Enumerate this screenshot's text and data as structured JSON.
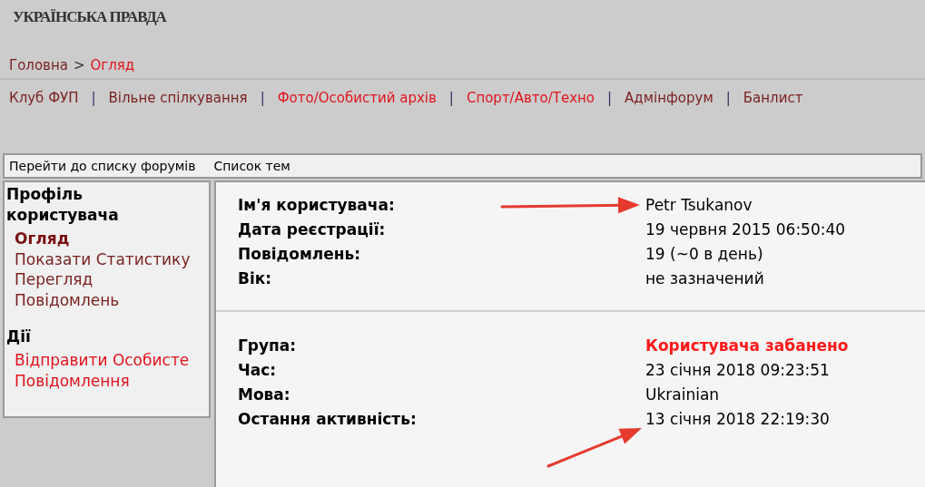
{
  "logo": "УКРАЇНСЬКА ПРАВДА",
  "breadcrumb": {
    "separator": ">",
    "items": [
      {
        "label": "Головна",
        "color": "#7a1f1f"
      },
      {
        "label": "Огляд",
        "color": "#e0141e"
      }
    ]
  },
  "forums": {
    "separator": "|",
    "items": [
      {
        "label": "Клуб ФУП",
        "color": "#7a1f1f"
      },
      {
        "label": "Вільне спілкування",
        "color": "#7a1f1f"
      },
      {
        "label": "Фото/Особистий архів",
        "color": "#e0141e"
      },
      {
        "label": "Спорт/Авто/Техно",
        "color": "#e0141e"
      },
      {
        "label": "Адмінфорум",
        "color": "#7a1f1f"
      },
      {
        "label": "Банлист",
        "color": "#7a1f1f"
      }
    ]
  },
  "toolbar": [
    "Перейти до списку форумів",
    "Список тем"
  ],
  "sidebar": [
    {
      "title": "Профіль користувача",
      "items": [
        {
          "label": "Огляд",
          "selected": true,
          "color": "#7a1010"
        },
        {
          "label": "Показати Статистику",
          "selected": false,
          "color": "#7a1f1f"
        },
        {
          "label": "Перегляд Повідомлень",
          "selected": false,
          "color": "#7a1f1f"
        }
      ]
    },
    {
      "title": "Дії",
      "items": [
        {
          "label": "Відправити Особисте Повідомлення",
          "selected": false,
          "color": "#e0141e"
        }
      ]
    }
  ],
  "profile": [
    [
      {
        "label": "Ім'я користувача:",
        "value": "Petr Tsukanov",
        "kind": "text"
      },
      {
        "label": "Дата реєстрації:",
        "value": "19 червня 2015 06:50:40",
        "kind": "text"
      },
      {
        "label": "Повідомлень:",
        "value": "19 (~0 в день)",
        "kind": "text"
      },
      {
        "label": "Вік:",
        "value": "не зазначений",
        "kind": "text"
      }
    ],
    [
      {
        "label": "Група:",
        "value": "Користувача забанено",
        "kind": "alert"
      },
      {
        "label": "Час:",
        "value": "23 січня 2018 09:23:51",
        "kind": "text"
      },
      {
        "label": "Мова:",
        "value": "Ukrainian",
        "kind": "text"
      },
      {
        "label": "Остання активність:",
        "value": "13 січня 2018 22:19:30",
        "kind": "text"
      }
    ]
  ]
}
